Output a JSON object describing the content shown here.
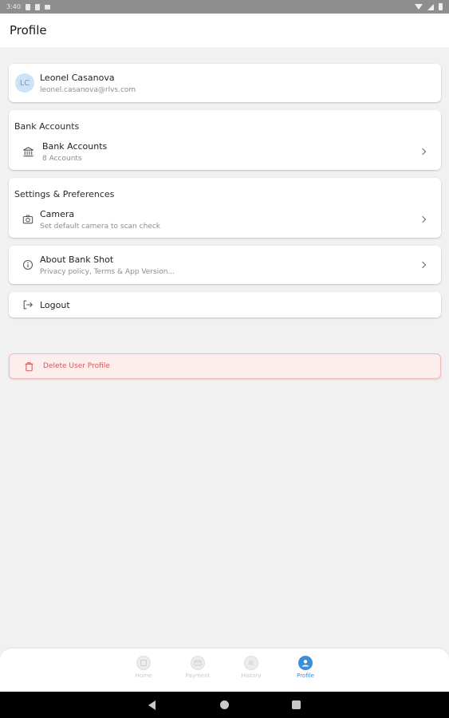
{
  "status_bar": {
    "time": "3:40"
  },
  "header": {
    "title": "Profile"
  },
  "user": {
    "initials": "LC",
    "name": "Leonel Casanova",
    "email": "leonel.casanova@rlvs.com"
  },
  "bank_section": {
    "title": "Bank Accounts",
    "item_title": "Bank Accounts",
    "item_subtitle": "8 Accounts"
  },
  "settings_section": {
    "title": "Settings & Preferences",
    "item_title": "Camera",
    "item_subtitle": "Set default camera to scan check"
  },
  "about": {
    "title": "About Bank Shot",
    "subtitle": "Privacy policy, Terms & App Version..."
  },
  "logout": {
    "label": "Logout"
  },
  "delete": {
    "label": "Delete User Profile"
  },
  "bottom_nav": {
    "items": [
      {
        "label": "Home",
        "icon": "home-icon"
      },
      {
        "label": "Payment",
        "icon": "payment-icon"
      },
      {
        "label": "History",
        "icon": "history-icon"
      },
      {
        "label": "Profile",
        "icon": "profile-icon"
      }
    ]
  },
  "colors": {
    "accent": "#3d8ed6",
    "danger": "#d35a5a",
    "danger_bg": "#fdeeee"
  }
}
